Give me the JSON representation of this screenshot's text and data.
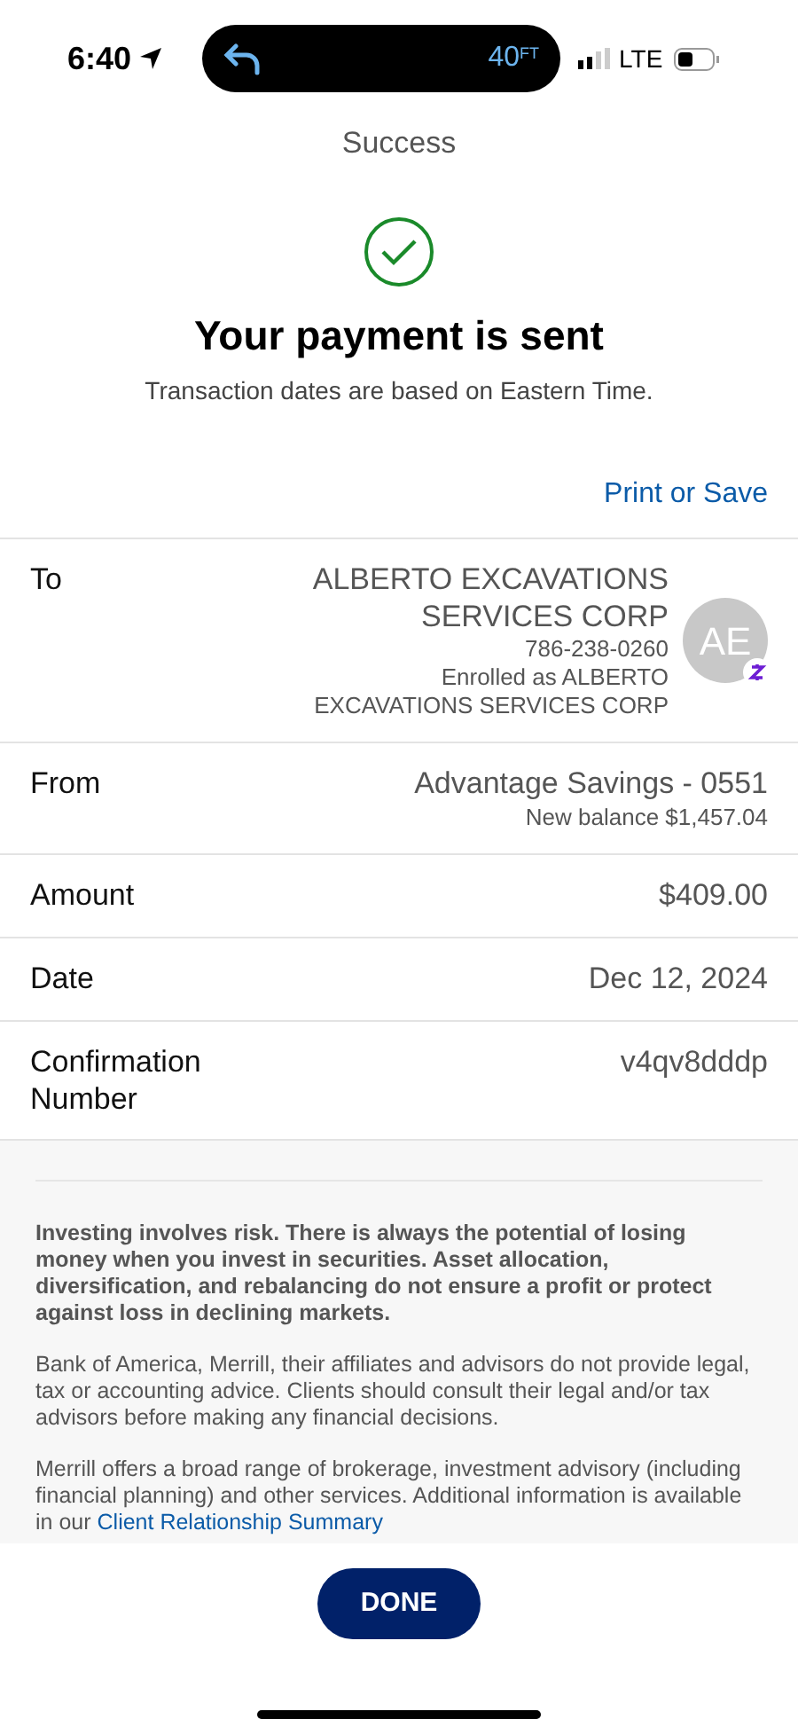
{
  "status_bar": {
    "time": "6:40",
    "island_reading": "40",
    "island_unit": "FT",
    "network": "LTE"
  },
  "header": {
    "title": "Success"
  },
  "confirmation": {
    "heading": "Your payment is sent",
    "subtitle": "Transaction dates are based on Eastern Time."
  },
  "print_link": "Print or Save",
  "details": [
    {
      "kind": "recipient",
      "label": "To",
      "value": "ALBERTO EXCAVATIONS SERVICES CORP",
      "lines": [
        "786-238-0260",
        "Enrolled as ALBERTO EXCAVATIONS SERVICES CORP"
      ],
      "avatar": "AE"
    },
    {
      "kind": "account",
      "label": "From",
      "value": "Advantage Savings - 0551",
      "lines": [
        "New balance $1,457.04"
      ]
    },
    {
      "kind": "plain",
      "label": "Amount",
      "value": "$409.00"
    },
    {
      "kind": "plain",
      "label": "Date",
      "value": "Dec 12, 2024"
    },
    {
      "kind": "plain",
      "label": "Confirmation Number",
      "value": "v4qv8dddp"
    }
  ],
  "disclosures": [
    {
      "kind": "bold",
      "text": "Investing involves risk. There is always the potential of losing money when you invest in securities. Asset allocation, diversification, and rebalancing do not ensure a profit or protect against loss in declining markets."
    },
    {
      "kind": "plain",
      "text": "Bank of America, Merrill, their affiliates and advisors do not provide legal, tax or accounting advice. Clients should consult their legal and/or tax advisors before making any financial decisions."
    },
    {
      "kind": "link",
      "text": "Merrill offers a broad range of brokerage, investment advisory (including financial planning) and other services. Additional information is available in our",
      "link": "Client Relationship Summary"
    }
  ],
  "done_button": "DONE"
}
